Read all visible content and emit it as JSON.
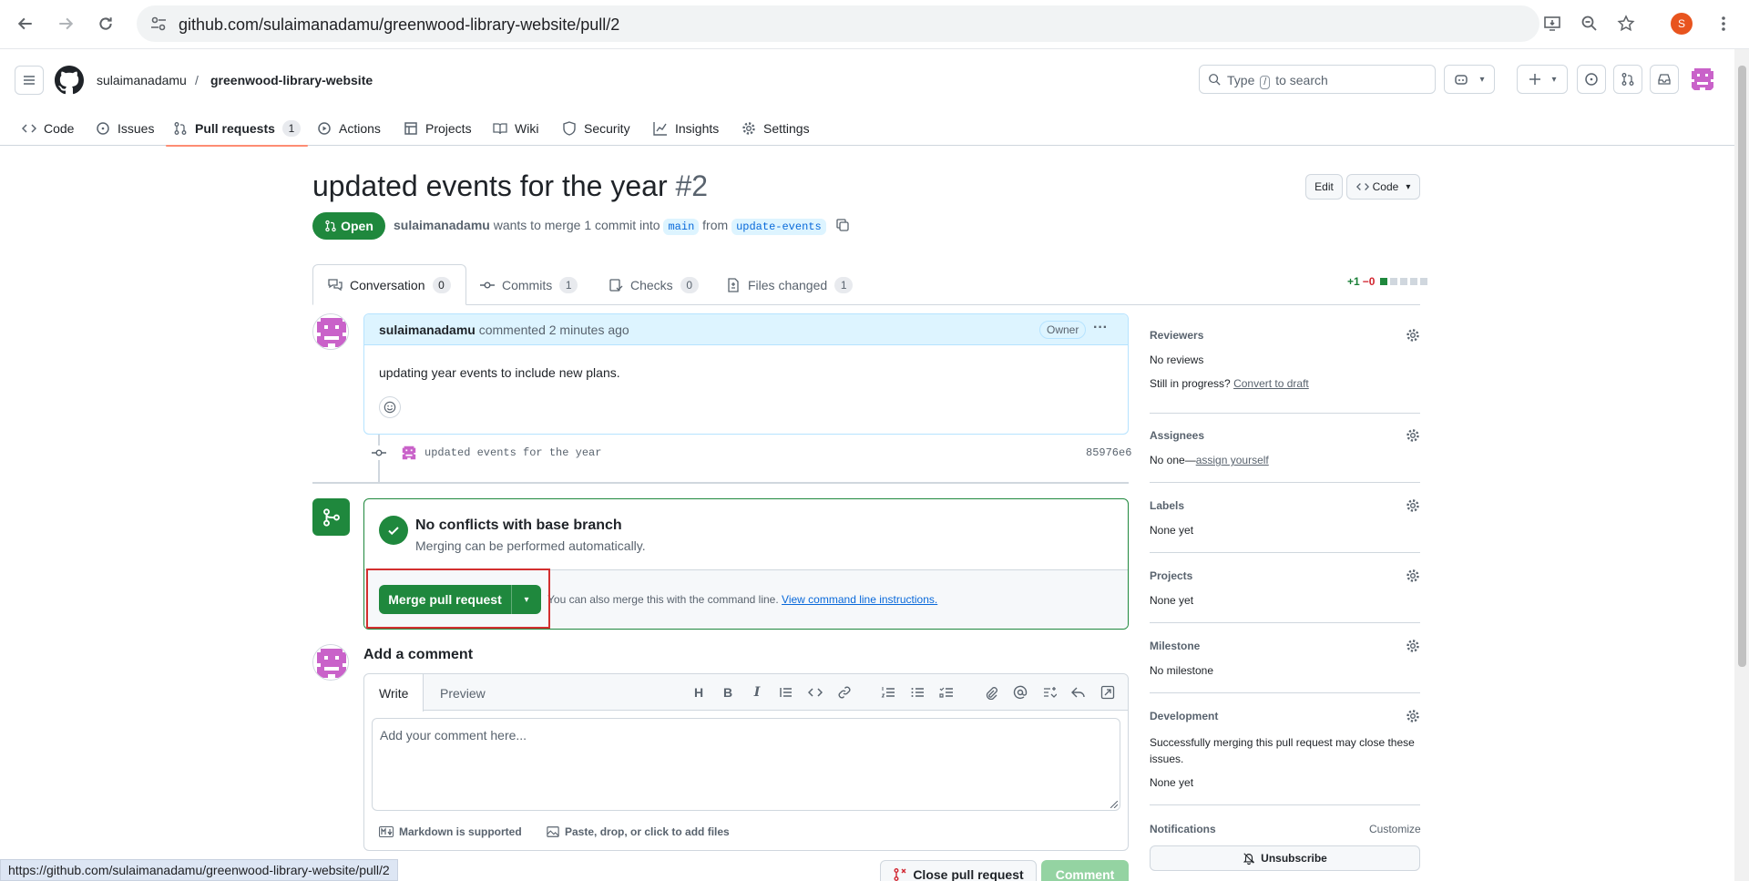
{
  "browser": {
    "url": "github.com/sulaimanadamu/greenwood-library-website/pull/2",
    "profile_initial": "S",
    "status_url": "https://github.com/sulaimanadamu/greenwood-library-website/pull/2"
  },
  "header": {
    "owner": "sulaimanadamu",
    "separator": "/",
    "repo": "greenwood-library-website",
    "search_placeholder_pre": "Type",
    "search_key": "/",
    "search_placeholder_post": "to search"
  },
  "repo_tabs": [
    {
      "label": "Code"
    },
    {
      "label": "Issues"
    },
    {
      "label": "Pull requests",
      "count": "1"
    },
    {
      "label": "Actions"
    },
    {
      "label": "Projects"
    },
    {
      "label": "Wiki"
    },
    {
      "label": "Security"
    },
    {
      "label": "Insights"
    },
    {
      "label": "Settings"
    }
  ],
  "pr": {
    "title": "updated events for the year",
    "number": "#2",
    "edit_label": "Edit",
    "code_label": "Code",
    "state": "Open",
    "author": "sulaimanadamu",
    "meta_mid": "wants to merge 1 commit into",
    "base": "main",
    "meta_from": "from",
    "head": "update-events"
  },
  "pr_tabs": [
    {
      "label": "Conversation",
      "count": "0"
    },
    {
      "label": "Commits",
      "count": "1"
    },
    {
      "label": "Checks",
      "count": "0"
    },
    {
      "label": "Files changed",
      "count": "1"
    }
  ],
  "diffstat": {
    "added": "+1",
    "removed": "−0"
  },
  "comment": {
    "author": "sulaimanadamu",
    "action": "commented 2 minutes ago",
    "badge": "Owner",
    "body": "updating year events to include new plans."
  },
  "commit": {
    "message": "updated events for the year",
    "sha": "85976e6"
  },
  "merge": {
    "title": "No conflicts with base branch",
    "subtitle": "Merging can be performed automatically.",
    "button": "Merge pull request",
    "hint": "You can also merge this with the command line.",
    "hint_link": "View command line instructions."
  },
  "editor": {
    "heading": "Add a comment",
    "tab_write": "Write",
    "tab_preview": "Preview",
    "placeholder": "Add your comment here...",
    "markdown": "Markdown is supported",
    "attach": "Paste, drop, or click to add files",
    "close_button": "Close pull request",
    "comment_button": "Comment"
  },
  "sidebar": {
    "reviewers": {
      "title": "Reviewers",
      "value": "No reviews",
      "draft_pre": "Still in progress?",
      "draft_link": "Convert to draft"
    },
    "assignees": {
      "title": "Assignees",
      "value_pre": "No one—",
      "value_link": "assign yourself"
    },
    "labels": {
      "title": "Labels",
      "value": "None yet"
    },
    "projects": {
      "title": "Projects",
      "value": "None yet"
    },
    "milestone": {
      "title": "Milestone",
      "value": "No milestone"
    },
    "development": {
      "title": "Development",
      "value": "Successfully merging this pull request may close these issues.",
      "value2": "None yet"
    },
    "notifications": {
      "title": "Notifications",
      "customize": "Customize",
      "button": "Unsubscribe"
    }
  },
  "colors": {
    "accent_green": "#1f883d",
    "link_blue": "#0969da",
    "active_tab": "#fd8c73",
    "highlight_red": "#d32f2f"
  }
}
